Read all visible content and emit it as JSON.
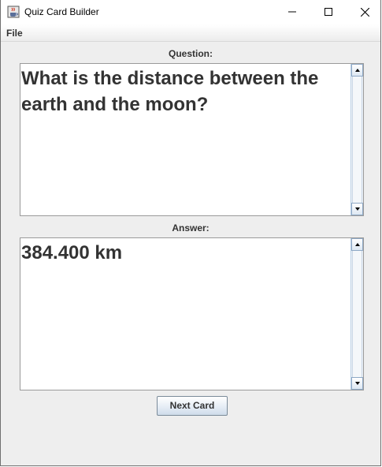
{
  "window": {
    "title": "Quiz Card Builder",
    "icon": "java-coffee-cup-icon",
    "controls": [
      "minimize-icon",
      "maximize-icon",
      "close-icon"
    ]
  },
  "menu": {
    "items": [
      {
        "label": "File"
      }
    ]
  },
  "question": {
    "label": "Question:",
    "value": "What is the distance between the earth and the moon?"
  },
  "answer": {
    "label": "Answer:",
    "value": "384.400 km"
  },
  "buttons": {
    "next_card": "Next Card"
  },
  "colors": {
    "window_bg": "#eeeeee",
    "text": "#333333",
    "scrollbar_border": "#8fa9c6"
  }
}
